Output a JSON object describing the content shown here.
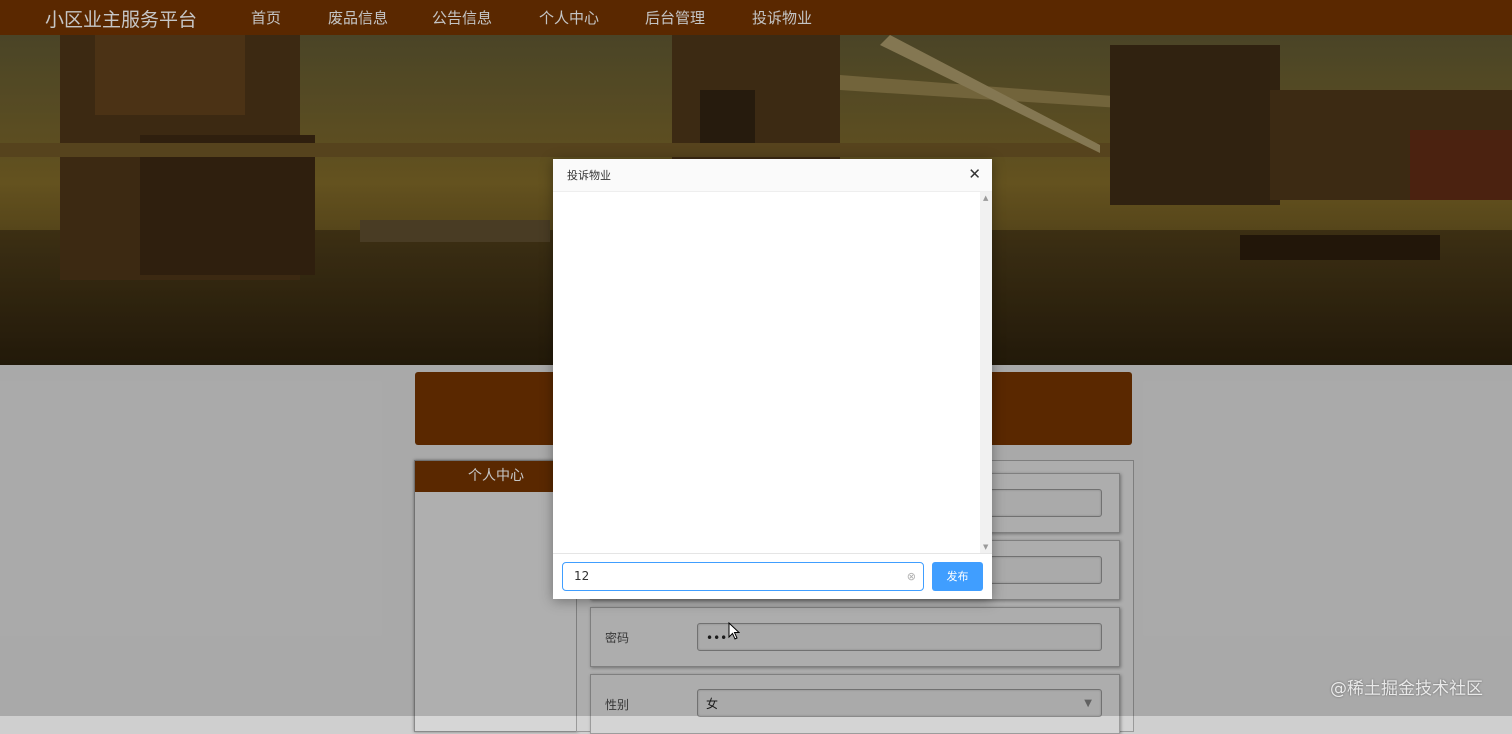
{
  "nav": {
    "brand": "小区业主服务平台",
    "items": [
      {
        "label": "首页"
      },
      {
        "label": "废品信息"
      },
      {
        "label": "公告信息"
      },
      {
        "label": "个人中心"
      },
      {
        "label": "后台管理"
      },
      {
        "label": "投诉物业"
      }
    ]
  },
  "sidebar": {
    "title": "个人中心"
  },
  "form": {
    "password_label": "密码",
    "password_value": "•••",
    "gender_label": "性别",
    "gender_value": "女"
  },
  "dialog": {
    "title": "投诉物业",
    "close_glyph": "✕",
    "input_value": "12",
    "publish_label": "发布",
    "clear_glyph": "⊗"
  },
  "watermark": "@稀土掘金技术社区",
  "colors": {
    "nav_brown": "#6e3100",
    "primary_blue": "#409eff"
  }
}
